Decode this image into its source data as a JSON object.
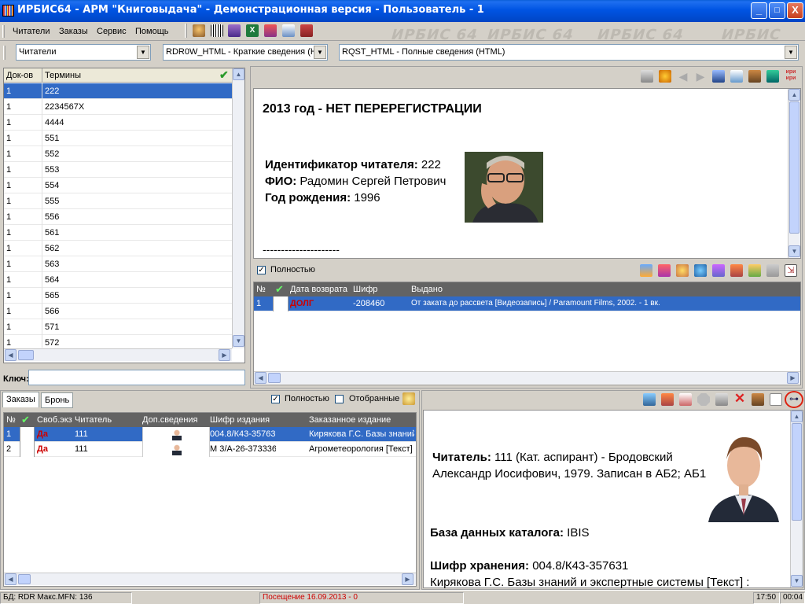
{
  "window": {
    "title": "ИРБИС64 - АРМ \"Книговыдача\" - Демонстрационная версия - Пользователь - 1",
    "minimize": "_",
    "maximize": "□",
    "close": "X"
  },
  "menu": [
    "Читатели",
    "Заказы",
    "Сервис",
    "Помощь"
  ],
  "watermark": [
    "ИРБИС 64",
    "ИРБИС 64",
    "ИРБИС 64",
    "ИРБИС 64"
  ],
  "combos": {
    "database": "Читатели",
    "short_format": "RDR0W_HTML - Краткие сведения (H",
    "full_format": "RQST_HTML - Полные сведения (HTML)"
  },
  "terms_grid": {
    "headers": [
      "Док-ов",
      "Термины"
    ],
    "rows": [
      [
        "1",
        "222"
      ],
      [
        "1",
        "2234567X"
      ],
      [
        "1",
        "4444"
      ],
      [
        "1",
        "551"
      ],
      [
        "1",
        "552"
      ],
      [
        "1",
        "553"
      ],
      [
        "1",
        "554"
      ],
      [
        "1",
        "555"
      ],
      [
        "1",
        "556"
      ],
      [
        "1",
        "561"
      ],
      [
        "1",
        "562"
      ],
      [
        "1",
        "563"
      ],
      [
        "1",
        "564"
      ],
      [
        "1",
        "565"
      ],
      [
        "1",
        "566"
      ],
      [
        "1",
        "571"
      ],
      [
        "1",
        "572"
      ]
    ],
    "key_label": "Ключ:",
    "key_value": ""
  },
  "reader_view": {
    "heading": "2013 год - НЕТ ПЕРЕРЕГИСТРАЦИИ",
    "id_label": "Идентификатор читателя:",
    "id_value": " 222",
    "fio_label": "ФИО:",
    "fio_value": " Радомин Сергей Петрович",
    "birth_label": "Год рождения:",
    "birth_value": " 1996",
    "separator": "---------------------"
  },
  "loans": {
    "full_label": "Полностью",
    "headers": [
      "№",
      "",
      "Дата возврата",
      "Шифр",
      "Выдано"
    ],
    "rows": [
      [
        "1",
        "",
        "ДОЛГ",
        "-208460",
        "От заката до рассвета [Видеозапись] / Paramount Films, 2002. - 1 вк."
      ]
    ]
  },
  "orders": {
    "tabs": [
      "Заказы",
      "Бронь"
    ],
    "full_label": "Полностью",
    "selected_label": "Отобранные",
    "headers": [
      "№",
      "",
      "Своб.экз",
      "Читатель",
      "Доп.сведения",
      "Шифр издания",
      "Заказанное издание"
    ],
    "rows": [
      [
        "1",
        "",
        "Да",
        "111",
        "",
        "004.8/К43-357631",
        "Кирякова Г.С. Базы знаний"
      ],
      [
        "2",
        "",
        "Да",
        "111",
        "",
        "М 3/А-26-373336",
        "Агрометеорология [Текст]"
      ]
    ]
  },
  "order_view": {
    "reader_label": "Читатель:",
    "reader_value": " 111 (Кат. аспирант) - Бродовский Александр Иосифович, 1979. Записан в АБ2; АБ1",
    "catalog_label": "База данных каталога:",
    "catalog_value": " IBIS",
    "shelf_label": "Шифр хранения:",
    "shelf_value": " 004.8/К43-357631",
    "book_line": "Кирякова Г.С. Базы знаний и экспертные системы [Текст] :"
  },
  "status": {
    "db": "БД: RDR Макс.MFN: 136",
    "visit": "Посещение 16.09.2013 - 0",
    "time": "17:50",
    "counter": "00:04"
  },
  "colors": {
    "accent": "#316ac5",
    "debt": "#cc0000",
    "visit_text": "#cc0000"
  }
}
